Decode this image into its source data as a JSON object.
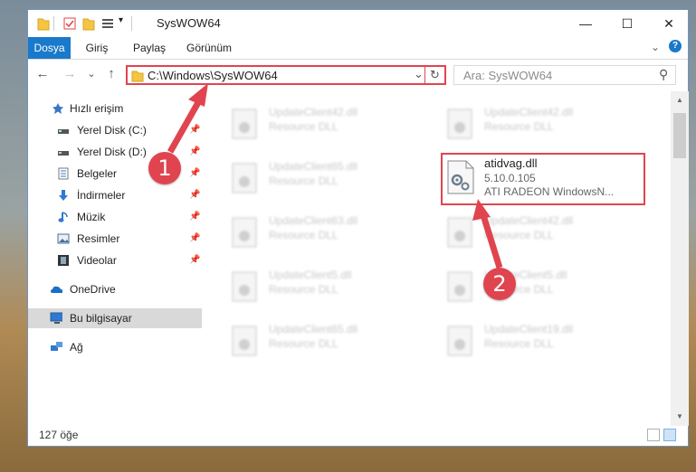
{
  "window": {
    "title": "SysWOW64"
  },
  "ribbon": {
    "tabs": [
      {
        "label": "Dosya"
      },
      {
        "label": "Giriş"
      },
      {
        "label": "Paylaş"
      },
      {
        "label": "Görünüm"
      }
    ],
    "help_glyph": "?",
    "expand_glyph": "⌄"
  },
  "titlebar": {
    "minimize": "—",
    "maximize": "☐",
    "close": "✕",
    "qa_dropdown": "▾"
  },
  "address": {
    "path": "C:\\Windows\\SysWOW64",
    "dropdown": "⌄",
    "refresh": "↻"
  },
  "nav": {
    "back": "←",
    "forward": "→",
    "history": "⌄",
    "up": "↑"
  },
  "search": {
    "placeholder": "Ara: SysWOW64",
    "icon": "⚲"
  },
  "sidebar": {
    "items": [
      {
        "label": "Hızlı erişim"
      },
      {
        "label": "Yerel Disk (C:)"
      },
      {
        "label": "Yerel Disk (D:)"
      },
      {
        "label": "Belgeler"
      },
      {
        "label": "İndirmeler"
      },
      {
        "label": "Müzik"
      },
      {
        "label": "Resimler"
      },
      {
        "label": "Videolar"
      },
      {
        "label": "OneDrive"
      },
      {
        "label": "Bu bilgisayar"
      },
      {
        "label": "Ağ"
      }
    ],
    "pin_glyph": "📌"
  },
  "files": {
    "left": [
      {
        "name": "UpdateClient42.dll",
        "desc": "Resource DLL"
      },
      {
        "name": "UpdateClient65.dll",
        "desc": "Resource DLL"
      },
      {
        "name": "UpdateClient63.dll",
        "desc": "Resource DLL"
      },
      {
        "name": "UpdateClient5.dll",
        "desc": "Resource DLL"
      },
      {
        "name": "UpdateClient65.dll",
        "desc": "Resource DLL"
      }
    ],
    "right": [
      {
        "name": "UpdateClient42.dll",
        "desc": "Resource DLL"
      },
      {
        "name": "UpdateClient42.dll",
        "desc": "Resource DLL"
      },
      {
        "name": "UpdateClient5.dll",
        "desc": "Resource DLL"
      },
      {
        "name": "UpdateClient19.dll",
        "desc": "Resource DLL"
      }
    ],
    "highlighted": {
      "name": "atidvag.dll",
      "version": "5.10.0.105",
      "description": "ATI RADEON WindowsN..."
    }
  },
  "status": {
    "count": "127 öğe"
  },
  "markers": {
    "one": "1",
    "two": "2"
  },
  "colors": {
    "accent": "#1979ca",
    "highlight": "#e0454f"
  }
}
